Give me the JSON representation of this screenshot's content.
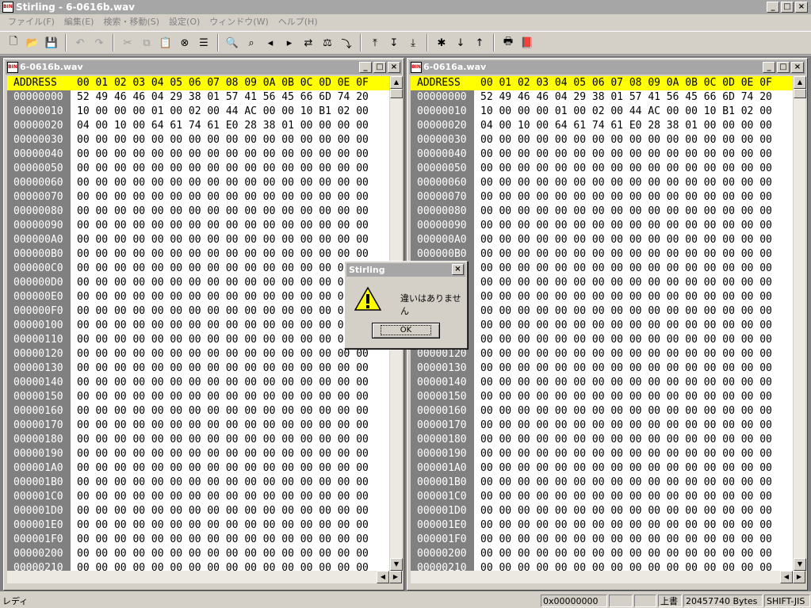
{
  "app": {
    "title": "Stirling - 6-0616b.wav",
    "icon_text": "BIN"
  },
  "window_controls": {
    "minimize": "_",
    "maximize": "□",
    "close": "×"
  },
  "menu": [
    "ファイル(F)",
    "編集(E)",
    "検索・移動(S)",
    "設定(O)",
    "ウィンドウ(W)",
    "ヘルプ(H)"
  ],
  "toolbar": [
    {
      "name": "new-file-button",
      "icon": "🗋",
      "enabled": true
    },
    {
      "name": "open-file-button",
      "icon": "📂",
      "enabled": true
    },
    {
      "name": "save-file-button",
      "icon": "💾",
      "enabled": true
    },
    {
      "sep": true
    },
    {
      "name": "undo-button",
      "icon": "↶",
      "enabled": false
    },
    {
      "name": "redo-button",
      "icon": "↷",
      "enabled": false
    },
    {
      "sep": true
    },
    {
      "name": "cut-button",
      "icon": "✂",
      "enabled": false
    },
    {
      "name": "copy-button",
      "icon": "⧉",
      "enabled": false
    },
    {
      "name": "paste-button",
      "icon": "📋",
      "enabled": true
    },
    {
      "name": "delete-button",
      "icon": "⊗",
      "enabled": true
    },
    {
      "name": "list-button",
      "icon": "☰",
      "enabled": true
    },
    {
      "sep": true
    },
    {
      "name": "find-button",
      "icon": "🔍",
      "enabled": true
    },
    {
      "name": "find-hex-button",
      "icon": "⌕",
      "enabled": true
    },
    {
      "name": "find-prev-button",
      "icon": "◂",
      "enabled": true
    },
    {
      "name": "find-next-button",
      "icon": "▸",
      "enabled": true
    },
    {
      "name": "replace-button",
      "icon": "⇄",
      "enabled": true
    },
    {
      "name": "compare-button",
      "icon": "⚖",
      "enabled": true
    },
    {
      "name": "jump-button",
      "icon": "⤵",
      "enabled": true
    },
    {
      "sep": true
    },
    {
      "name": "goto-top-button",
      "icon": "⤒",
      "enabled": true
    },
    {
      "name": "goto-address-button",
      "icon": "↧",
      "enabled": true
    },
    {
      "name": "goto-end-button",
      "icon": "⤓",
      "enabled": true
    },
    {
      "sep": true
    },
    {
      "name": "mark-button",
      "icon": "✱",
      "enabled": true
    },
    {
      "name": "mark-next-button",
      "icon": "↓",
      "enabled": true
    },
    {
      "name": "mark-prev-button",
      "icon": "↑",
      "enabled": true
    },
    {
      "sep": true
    },
    {
      "name": "print-button",
      "icon": "🖶",
      "enabled": true
    },
    {
      "name": "help-book-button",
      "icon": "📕",
      "enabled": true
    }
  ],
  "hex_header": {
    "address_label": "ADDRESS",
    "columns": "00 01 02 03 04 05 06 07 08 09 0A 0B 0C 0D 0E 0F"
  },
  "left_window": {
    "title": "6-0616b.wav",
    "rows": [
      {
        "addr": "00000000",
        "bytes": "52 49 46 46 04 29 38 01 57 41 56 45 66 6D 74 20"
      },
      {
        "addr": "00000010",
        "bytes": "10 00 00 00 01 00 02 00 44 AC 00 00 10 B1 02 00"
      },
      {
        "addr": "00000020",
        "bytes": "04 00 10 00 64 61 74 61 E0 28 38 01 00 00 00 00"
      },
      {
        "addr": "00000030",
        "bytes": "00 00 00 00 00 00 00 00 00 00 00 00 00 00 00 00"
      },
      {
        "addr": "00000040",
        "bytes": "00 00 00 00 00 00 00 00 00 00 00 00 00 00 00 00"
      },
      {
        "addr": "00000050",
        "bytes": "00 00 00 00 00 00 00 00 00 00 00 00 00 00 00 00"
      },
      {
        "addr": "00000060",
        "bytes": "00 00 00 00 00 00 00 00 00 00 00 00 00 00 00 00"
      },
      {
        "addr": "00000070",
        "bytes": "00 00 00 00 00 00 00 00 00 00 00 00 00 00 00 00"
      },
      {
        "addr": "00000080",
        "bytes": "00 00 00 00 00 00 00 00 00 00 00 00 00 00 00 00"
      },
      {
        "addr": "00000090",
        "bytes": "00 00 00 00 00 00 00 00 00 00 00 00 00 00 00 00"
      },
      {
        "addr": "000000A0",
        "bytes": "00 00 00 00 00 00 00 00 00 00 00 00 00 00 00 00"
      },
      {
        "addr": "000000B0",
        "bytes": "00 00 00 00 00 00 00 00 00 00 00 00 00 00 00 00"
      },
      {
        "addr": "000000C0",
        "bytes": "00 00 00 00 00 00 00 00 00 00 00 00 00 00 00 00"
      },
      {
        "addr": "000000D0",
        "bytes": "00 00 00 00 00 00 00 00 00 00 00 00 00 00 00 00"
      },
      {
        "addr": "000000E0",
        "bytes": "00 00 00 00 00 00 00 00 00 00 00 00 00 00 00 00"
      },
      {
        "addr": "000000F0",
        "bytes": "00 00 00 00 00 00 00 00 00 00 00 00 00 00 00 00"
      },
      {
        "addr": "00000100",
        "bytes": "00 00 00 00 00 00 00 00 00 00 00 00 00 00 00 00"
      },
      {
        "addr": "00000110",
        "bytes": "00 00 00 00 00 00 00 00 00 00 00 00 00 00 00 00"
      },
      {
        "addr": "00000120",
        "bytes": "00 00 00 00 00 00 00 00 00 00 00 00 00 00 00 00"
      },
      {
        "addr": "00000130",
        "bytes": "00 00 00 00 00 00 00 00 00 00 00 00 00 00 00 00"
      },
      {
        "addr": "00000140",
        "bytes": "00 00 00 00 00 00 00 00 00 00 00 00 00 00 00 00"
      },
      {
        "addr": "00000150",
        "bytes": "00 00 00 00 00 00 00 00 00 00 00 00 00 00 00 00"
      },
      {
        "addr": "00000160",
        "bytes": "00 00 00 00 00 00 00 00 00 00 00 00 00 00 00 00"
      },
      {
        "addr": "00000170",
        "bytes": "00 00 00 00 00 00 00 00 00 00 00 00 00 00 00 00"
      },
      {
        "addr": "00000180",
        "bytes": "00 00 00 00 00 00 00 00 00 00 00 00 00 00 00 00"
      },
      {
        "addr": "00000190",
        "bytes": "00 00 00 00 00 00 00 00 00 00 00 00 00 00 00 00"
      },
      {
        "addr": "000001A0",
        "bytes": "00 00 00 00 00 00 00 00 00 00 00 00 00 00 00 00"
      },
      {
        "addr": "000001B0",
        "bytes": "00 00 00 00 00 00 00 00 00 00 00 00 00 00 00 00"
      },
      {
        "addr": "000001C0",
        "bytes": "00 00 00 00 00 00 00 00 00 00 00 00 00 00 00 00"
      },
      {
        "addr": "000001D0",
        "bytes": "00 00 00 00 00 00 00 00 00 00 00 00 00 00 00 00"
      },
      {
        "addr": "000001E0",
        "bytes": "00 00 00 00 00 00 00 00 00 00 00 00 00 00 00 00"
      },
      {
        "addr": "000001F0",
        "bytes": "00 00 00 00 00 00 00 00 00 00 00 00 00 00 00 00"
      },
      {
        "addr": "00000200",
        "bytes": "00 00 00 00 00 00 00 00 00 00 00 00 00 00 00 00"
      },
      {
        "addr": "00000210",
        "bytes": "00 00 00 00 00 00 00 00 00 00 00 00 00 00 00 00"
      }
    ]
  },
  "right_window": {
    "title": "6-0616a.wav",
    "rows": [
      {
        "addr": "00000000",
        "bytes": "52 49 46 46 04 29 38 01 57 41 56 45 66 6D 74 20"
      },
      {
        "addr": "00000010",
        "bytes": "10 00 00 00 01 00 02 00 44 AC 00 00 10 B1 02 00"
      },
      {
        "addr": "00000020",
        "bytes": "04 00 10 00 64 61 74 61 E0 28 38 01 00 00 00 00"
      },
      {
        "addr": "00000030",
        "bytes": "00 00 00 00 00 00 00 00 00 00 00 00 00 00 00 00"
      },
      {
        "addr": "00000040",
        "bytes": "00 00 00 00 00 00 00 00 00 00 00 00 00 00 00 00"
      },
      {
        "addr": "00000050",
        "bytes": "00 00 00 00 00 00 00 00 00 00 00 00 00 00 00 00"
      },
      {
        "addr": "00000060",
        "bytes": "00 00 00 00 00 00 00 00 00 00 00 00 00 00 00 00"
      },
      {
        "addr": "00000070",
        "bytes": "00 00 00 00 00 00 00 00 00 00 00 00 00 00 00 00"
      },
      {
        "addr": "00000080",
        "bytes": "00 00 00 00 00 00 00 00 00 00 00 00 00 00 00 00"
      },
      {
        "addr": "00000090",
        "bytes": "00 00 00 00 00 00 00 00 00 00 00 00 00 00 00 00"
      },
      {
        "addr": "000000A0",
        "bytes": "00 00 00 00 00 00 00 00 00 00 00 00 00 00 00 00"
      },
      {
        "addr": "000000B0",
        "bytes": "00 00 00 00 00 00 00 00 00 00 00 00 00 00 00 00"
      },
      {
        "addr": "000000C0",
        "bytes": "00 00 00 00 00 00 00 00 00 00 00 00 00 00 00 00"
      },
      {
        "addr": "000000D0",
        "bytes": "00 00 00 00 00 00 00 00 00 00 00 00 00 00 00 00"
      },
      {
        "addr": "000000E0",
        "bytes": "00 00 00 00 00 00 00 00 00 00 00 00 00 00 00 00"
      },
      {
        "addr": "000000F0",
        "bytes": "00 00 00 00 00 00 00 00 00 00 00 00 00 00 00 00"
      },
      {
        "addr": "00000100",
        "bytes": "00 00 00 00 00 00 00 00 00 00 00 00 00 00 00 00"
      },
      {
        "addr": "00000110",
        "bytes": "00 00 00 00 00 00 00 00 00 00 00 00 00 00 00 00"
      },
      {
        "addr": "00000120",
        "bytes": "00 00 00 00 00 00 00 00 00 00 00 00 00 00 00 00"
      },
      {
        "addr": "00000130",
        "bytes": "00 00 00 00 00 00 00 00 00 00 00 00 00 00 00 00"
      },
      {
        "addr": "00000140",
        "bytes": "00 00 00 00 00 00 00 00 00 00 00 00 00 00 00 00"
      },
      {
        "addr": "00000150",
        "bytes": "00 00 00 00 00 00 00 00 00 00 00 00 00 00 00 00"
      },
      {
        "addr": "00000160",
        "bytes": "00 00 00 00 00 00 00 00 00 00 00 00 00 00 00 00"
      },
      {
        "addr": "00000170",
        "bytes": "00 00 00 00 00 00 00 00 00 00 00 00 00 00 00 00"
      },
      {
        "addr": "00000180",
        "bytes": "00 00 00 00 00 00 00 00 00 00 00 00 00 00 00 00"
      },
      {
        "addr": "00000190",
        "bytes": "00 00 00 00 00 00 00 00 00 00 00 00 00 00 00 00"
      },
      {
        "addr": "000001A0",
        "bytes": "00 00 00 00 00 00 00 00 00 00 00 00 00 00 00 00"
      },
      {
        "addr": "000001B0",
        "bytes": "00 00 00 00 00 00 00 00 00 00 00 00 00 00 00 00"
      },
      {
        "addr": "000001C0",
        "bytes": "00 00 00 00 00 00 00 00 00 00 00 00 00 00 00 00"
      },
      {
        "addr": "000001D0",
        "bytes": "00 00 00 00 00 00 00 00 00 00 00 00 00 00 00 00"
      },
      {
        "addr": "000001E0",
        "bytes": "00 00 00 00 00 00 00 00 00 00 00 00 00 00 00 00"
      },
      {
        "addr": "000001F0",
        "bytes": "00 00 00 00 00 00 00 00 00 00 00 00 00 00 00 00"
      },
      {
        "addr": "00000200",
        "bytes": "00 00 00 00 00 00 00 00 00 00 00 00 00 00 00 00"
      },
      {
        "addr": "00000210",
        "bytes": "00 00 00 00 00 00 00 00 00 00 00 00 00 00 00 00"
      }
    ]
  },
  "dialog": {
    "title": "Stirling",
    "message": "違いはありません",
    "ok_label": "OK",
    "close": "×"
  },
  "scroll_arrows": {
    "up": "▲",
    "down": "▼",
    "left": "◀",
    "right": "▶"
  },
  "status": {
    "ready": "レディ",
    "position": "0x00000000",
    "mode": "上書",
    "size": "20457740 Bytes",
    "encoding": "SHIFT-JIS"
  },
  "colors": {
    "header_highlight": "#ffff00",
    "address_column": "#808080",
    "inactive_title": "#a6a6a6"
  }
}
